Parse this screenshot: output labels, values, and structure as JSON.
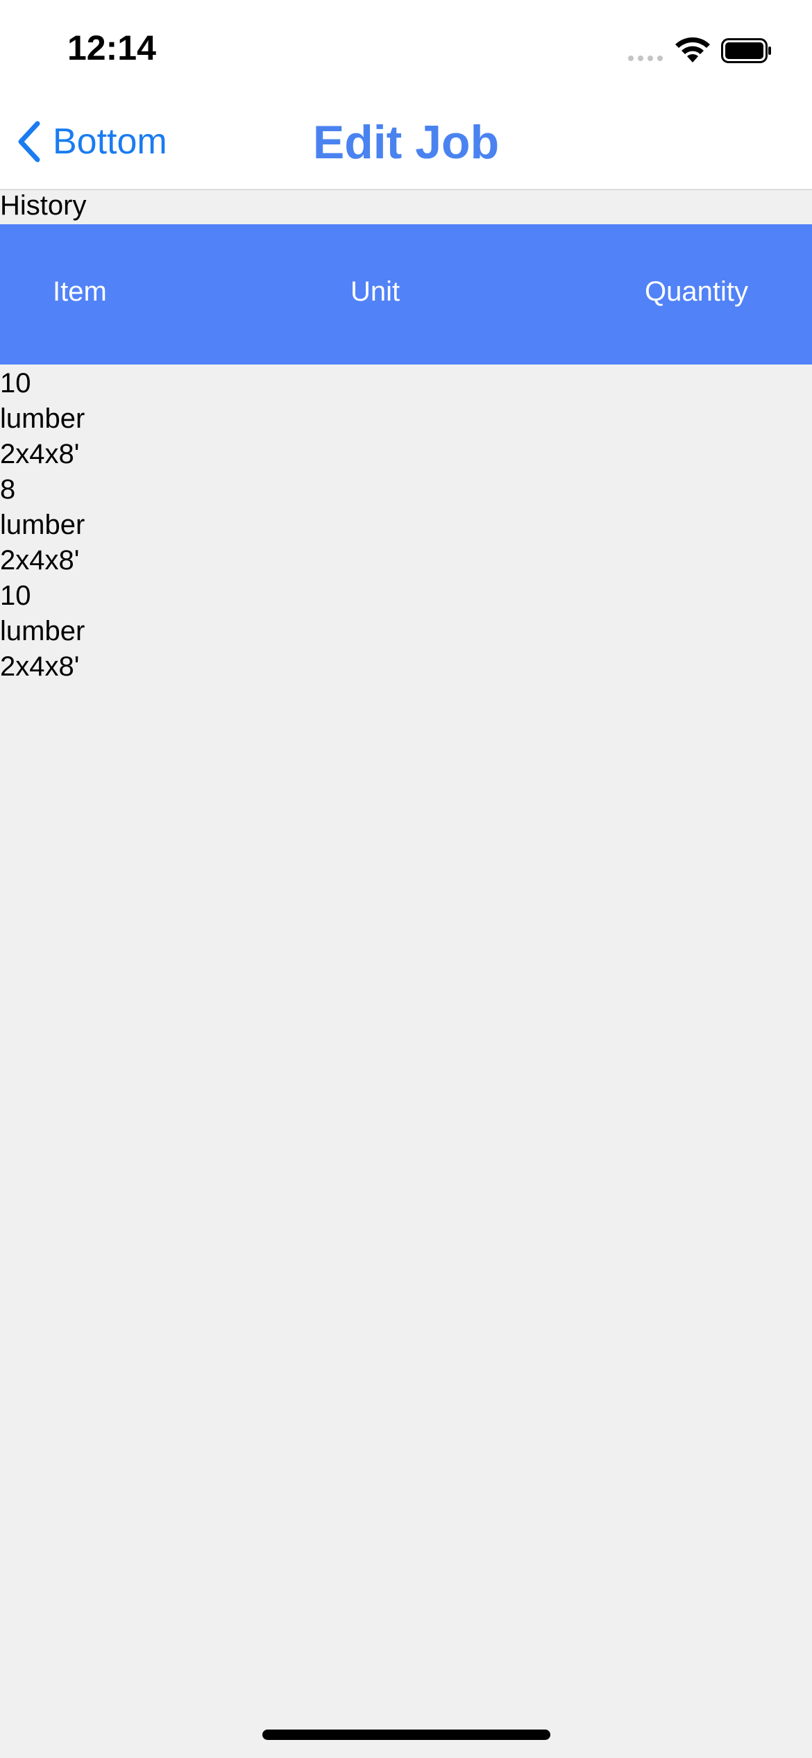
{
  "status_bar": {
    "time": "12:14"
  },
  "nav": {
    "back_label": "Bottom",
    "title": "Edit Job"
  },
  "section": {
    "label": "History"
  },
  "table": {
    "columns": [
      "Item",
      "Unit",
      "Quantity"
    ],
    "rows": [
      {
        "quantity": "10",
        "item": "lumber",
        "unit": "2x4x8'"
      },
      {
        "quantity": "8",
        "item": "lumber",
        "unit": "2x4x8'"
      },
      {
        "quantity": "10",
        "item": "lumber",
        "unit": "2x4x8'"
      }
    ]
  },
  "colors": {
    "accent": "#1a7cf0",
    "title": "#4a83f0",
    "header_bg": "#5182f7",
    "page_bg": "#f0f0f0"
  }
}
